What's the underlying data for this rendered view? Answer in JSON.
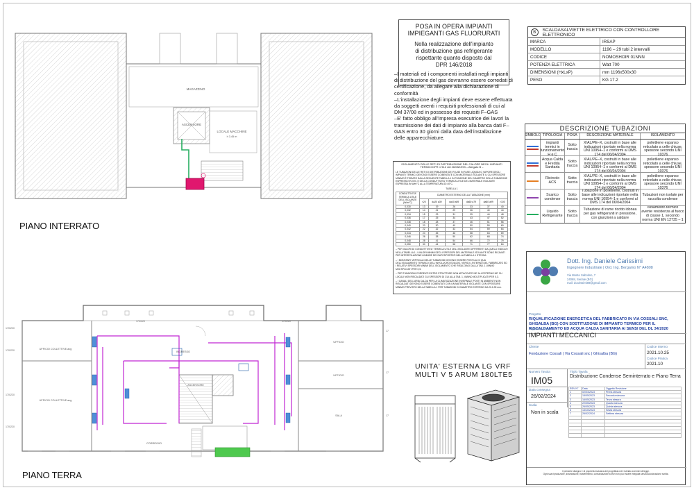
{
  "plans": {
    "interrato_label": "PIANO INTERRATO",
    "terra_label": "PIANO TERRA",
    "rooms_interrato": {
      "magazzino": "MAGAZZINO",
      "ascensore": "ASCENSORE",
      "locale_macchine": "LOCALE MACCHINE",
      "locale_h": "h 3.45 m"
    },
    "rooms_terra": {
      "r1": "UFFICIO COLLETTIVE.avg",
      "r2": "UFFICIO COLLETTIVE.avg",
      "r3": "INGRESSO",
      "r4": "ASCENSORE",
      "r5": "UFFICIO",
      "r6": "UFFICIO",
      "r7": "SALA",
      "r8": "CORRIDOIO"
    }
  },
  "posa": {
    "title_line1": "POSA IN OPERA IMPIANTI",
    "title_line2": "IMPIEGANTI GAS FLUORURATI",
    "sub1": "Nella realizzazione dell'impianto",
    "sub2": "di distribuzione gas refrigerante",
    "sub3": "rispettante quanto disposto dal",
    "sub4": "DPR 146/2018",
    "note1": "–I materiali ed i componenti installati negli impianti di distribuzione del gas dovranno essere corredati di certificazione, da allegare alla dichiarazione di conformità",
    "note2": "–L'installazione degli impianti deve essere effettuata da soggetti aventi i requisiti professionali di cui al DM 37/08 ed in possesso dei requisiti F–GAS",
    "note3": "–E' fatto obbligo all'impresa esecutrice dei lavori la trasmissione dei dati di impianto alla banca dati F–GAS entro 30 giorni dalla data dell'installazione delle apparecchiature."
  },
  "scaldasalviette": {
    "badge": "B",
    "title": "SCALDASALVIETTE ELETTRICO CON CONTROLLORE ELETTRONICO",
    "rows": [
      {
        "k": "MARCA",
        "v": "IRSAP"
      },
      {
        "k": "MODELLO",
        "v": "1196 – 29 tubi 2 intervalli"
      },
      {
        "k": "CODICE",
        "v": "NOMOSHOIR 01NNN"
      },
      {
        "k": "POTENZA ELETTRICA",
        "v": "Watt   700"
      },
      {
        "k": "DIMENSIONI (HxLxP)",
        "v": "mm   1196x500x30"
      },
      {
        "k": "PESO",
        "v": "KG   17.2"
      }
    ]
  },
  "tubazioni": {
    "title": "DESCRIZIONE TUBAZIONI",
    "headers": [
      "SIMBOLO",
      "TIPOLOGIA",
      "POSA",
      "DESCRIZIONE MATERIALE",
      "ISOLAMENTO"
    ],
    "rows": [
      {
        "color": "#2f6fd6",
        "color2": "#c0392b",
        "tipologia": "Circuito impianti termici in funzionamento H e C",
        "posa": "Sotto traccia",
        "descr": "Tubazione in multistrato PE–X/AL/PE–X, costruiti in base alle indicazioni riportate nella norma UNI 10954–1 e conformi al DMS 174 del 06/04/2004",
        "iso": "Isolamento termico in polietilene espanso reticolato a celle chiuse, spessore secondo UNI 10376"
      },
      {
        "color": "#2f6fd6",
        "color2": "#c0392b",
        "tipologia": "Acqua Calda e Fredda Sanitaria",
        "posa": "Sotto traccia",
        "descr": "Tubazione in multistrato PE–X/AL/PE–X, costruiti in base alle indicazioni riportate nella norma UNI 10954–1 e conformi al DMS 174 del 06/04/2004",
        "iso": "Isolamento termico in polietilene espanso reticolato a celle chiuse, spessore secondo UNI 10376"
      },
      {
        "color": "#e67e22",
        "color2": "",
        "tipologia": "Ricircolo ACS",
        "posa": "Sotto traccia",
        "descr": "Tubazione in multistrato PE–X/AL/PE–X, costruiti in base alle indicazioni riportate nella norma UNI 10954–1 e conformi al DMS 174 del 06/04/2004",
        "iso": "Isolamento termico in polietilene espanso reticolato a celle chiuse, spessore secondo UNI 10376"
      },
      {
        "color": "#8e44ad",
        "color2": "",
        "tipologia": "Scarico condense",
        "posa": "Sotto traccia",
        "descr": "Tubazione in polietilene, costruiti in base alle indicazioni riportate nella norma UNI 10954–1 e conformi al DMS 174 del 06/04/2004",
        "iso": "Tubazioni non isolate per raccolta condense"
      },
      {
        "color": "#27ae60",
        "color2": "",
        "tipologia": "Liquido Refrigerante",
        "posa": "Sotto traccia",
        "descr": "Tubazione di rame ricotto idonea per gas refrigeranti in pressione, con giunzioni a saldare",
        "iso": "Isolamento termico avente resistenza al fuoco di classe 1, secondo norma UNI EN 12735 – 1"
      }
    ]
  },
  "isolamento": {
    "title": "ISOLAMENTO DELLE RETI DI DISTRIBUZIONE DEL CALORE NEGLI IMPIANTI TERMICI DPR n°412 del 26/08/1993 – Allegato B –",
    "text1": "LE TUBAZIONI DELLE RETI DI DISTRIBUZIONE DEI FLUIDI IN FASE LIQUIDA O VAPORE DEGLI IMPIANTI TERMICI DEVONO ESSERE COIBENTATE CON MATERIALE ISOLANTE IL CUI SPESSORE MINIMO È FISSATO DALLA SEGUENTE TABELLA 1 IN FUNZIONE DEL DIAMETRO DELLA TUBAZIONE ESPRESSO IN mm. E DELLA CONDUTTIVITA' TERMICA UTILE DEL MATERIALE ISOLANTE ESPRESSA IN W/m°C ALLA TEMPERATURA DI 40°C.",
    "table_label": "TABELLA 1",
    "col_head_left": "CONDUTTIVITA' TERMICA UTILE DELL'ISOLANTE (W/m°C)",
    "col_head_right": "DIAMETRO ESTERNO DELLA TUBAZIONE (mm)",
    "diam": [
      "<20",
      "da20 a39",
      "da40 a59",
      "da60 a79",
      "da80 a99",
      ">100"
    ],
    "rows": [
      [
        "0,030",
        "13",
        "19",
        "26",
        "33",
        "37",
        "40"
      ],
      [
        "0,032",
        "14",
        "21",
        "29",
        "36",
        "40",
        "44"
      ],
      [
        "0,034",
        "15",
        "23",
        "31",
        "39",
        "44",
        "48"
      ],
      [
        "0,036",
        "17",
        "25",
        "34",
        "43",
        "47",
        "52"
      ],
      [
        "0,038",
        "18",
        "28",
        "37",
        "46",
        "51",
        "56"
      ],
      [
        "0,040",
        "20",
        "30",
        "40",
        "50",
        "55",
        "60"
      ],
      [
        "0,042",
        "22",
        "32",
        "43",
        "54",
        "59",
        "64"
      ],
      [
        "0,044",
        "24",
        "35",
        "46",
        "58",
        "63",
        "69"
      ],
      [
        "0,046",
        "26",
        "38",
        "50",
        "62",
        "68",
        "74"
      ],
      [
        "0,048",
        "28",
        "41",
        "54",
        "66",
        "72",
        "79"
      ],
      [
        "0,050",
        "30",
        "44",
        "58",
        "71",
        "77",
        "84"
      ]
    ],
    "text2": "– PER VALORI DI CONDUTTIVITA' TERMICA UTILE DELL'ISOLANTE DIFFERENTI DA QUELLI INDICATI NELLA TABELLA 1, I VALORI MINIMI DEGLI SPESSORI DEL MATERIALE ISOLANTE SONO RICAVATI PER INTERPOLAZIONE LINEARE DEI DATI RIPORTATI NELLA TABELLA 1 STESSA.",
    "text3": "– I MONTANTI VERTICALI DELLE TUBAZIONI DEVONO ESSERE POSTI AL DI QUA DELL'ISOLAMENTO TERMICO DELL'INVOLUCRO EDILIZIO, VERSO L'INTERNO DEL FABBRICATO ED I RELATIVI SPESSORI MINIMI DELL'ISOLAMENTO CHE RISULTANO DALLA TAB. 1 VANNO MOLTIPLICATI PER 0,5.",
    "text4": "– PER TUBAZIONI CORRENTI ENTRO STRUTTURE NON AFFACCIATE NE' ALL'ESTERNO NE' SU LOCALI NON RISCALDATI GLI SPESSORI DI CUI ALLA TAB. 1, VANNO MOLTIPLICATI PER 0,3.",
    "text5": "– I CANALI DELL'ARIA CALDA PER LA CLIMATIZZAZIONE INVERNALE POSTI IN AMBIENTI NON RISCALDATI DEVONO ESSERE COIBENTATI CON UN MATERIALE ISOLANTE CON SPESSORE MINIMO PREVISTO NELLA TABELLA 1 PER TUBAZIONI DI DIAMETRO ESTERNO DA 20 A 39 mm."
  },
  "unita_esterna": {
    "line1": "UNITA' ESTERNA LG VRF",
    "line2": "MULTI V 5 ARUM 180LTE5"
  },
  "title_block": {
    "eng_name": "Dott. Ing. Daniele Carissimi",
    "eng_sub": "Ingegnere Industriale | Ord. Ing. Bergamo N° A4808",
    "eng_addr1": "Via Monte Sabotino, 7",
    "eng_addr2": "24068, Seriate (BG)",
    "eng_addr3": "mail: dcarissimi89@gmail.com",
    "progetto_lbl": "Progetto",
    "progetto": "RIQUALIFICAZIONE ENERGETICA DEL FABBRICATO IN VIA COSSALI SNC, GHISALBA (BG) CON SOSTITUZIONE DI IMPIANTO TERMICO PER IL RISCALDAMENTO ED ACQUA CALDA SANITARIA  AI SENSI DEL DL 34/2020",
    "oggetto_lbl": "Oggetto Tavola",
    "oggetto": "IMPIANTI MECCANICI",
    "cliente_lbl": "Cliente",
    "cliente": "Fondazione Cossali | Via Cossali snc | Ghisalba (BG)",
    "codice_lbl": "Codice Interno",
    "codice": "2021.10.25",
    "codice_pratica_lbl": "Codice Pratica",
    "codice_pratica": "2021.10",
    "numero_lbl": "Numero Tavola",
    "numero": "IM05",
    "titolo_lbl": "Titolo Tavola",
    "titolo": "Distribuzione Condense Seminterrato e Piano Terra",
    "data_lbl": "Data consegna",
    "data": "26/02/2024",
    "scala_lbl": "Scala",
    "scala": "Non in scala",
    "rev_headers": [
      "REV N°",
      "Data",
      "Oggetto Revisione"
    ],
    "revisions": [
      [
        "1",
        "02/04/2023",
        "Prima stesura"
      ],
      [
        "2",
        "15/05/2023",
        "Seconda stesura"
      ],
      [
        "3",
        "16/05/2023",
        "Terza stesura"
      ],
      [
        "4",
        "22/05/2023",
        "Quarta stesura"
      ],
      [
        "5",
        "26/05/2023",
        "Quinta stesura"
      ],
      [
        "6",
        "13/10/2023",
        "Sesta stesura"
      ],
      [
        "7",
        "26/02/2024",
        "Settima stesura"
      ]
    ],
    "footer1": "Il presente disegno è di proprietà esclusiva del progettista ed è tutelato a termini di legge.",
    "footer2": "Ogni sua riproduzione, trasmissione, trasferimento, comunicazione a terzi non può essere eseguita senza autorizzazione scritta."
  },
  "colors": {
    "refrigerant": "#27ae60",
    "condense": "#c026d3",
    "unit": "#e0176e",
    "link_blue": "#1c3a9e"
  }
}
